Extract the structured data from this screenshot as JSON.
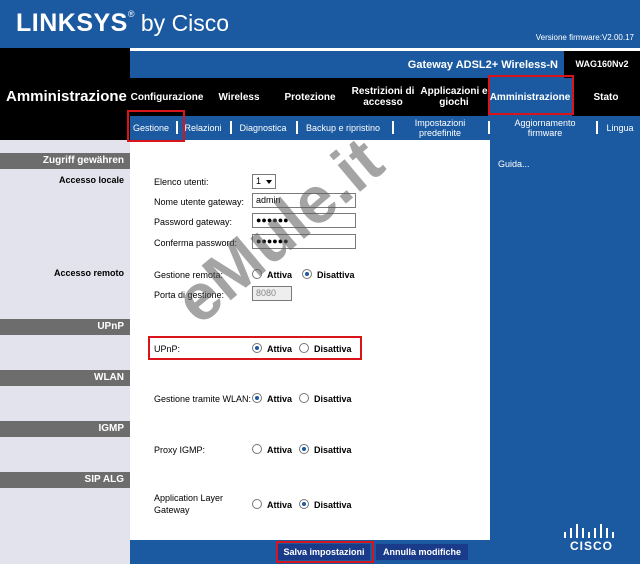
{
  "header": {
    "brand": "LINKSYS",
    "reg": "®",
    "by": " by Cisco",
    "firmware": "Versione firmware:V2.00.17",
    "section_title": "Amministrazione",
    "product_name": "Gateway ADSL2+ Wireless-N",
    "model": "WAG160Nv2"
  },
  "tabs": [
    {
      "label": "Configurazione"
    },
    {
      "label": "Wireless"
    },
    {
      "label": "Protezione"
    },
    {
      "label": "Restrizioni di accesso"
    },
    {
      "label": "Applicazioni e giochi"
    },
    {
      "label": "Amministrazione"
    },
    {
      "label": "Stato"
    }
  ],
  "subtabs": [
    {
      "label": "Gestione"
    },
    {
      "label": "Relazioni"
    },
    {
      "label": "Diagnostica"
    },
    {
      "label": "Backup e ripristino"
    },
    {
      "label": "Impostazioni predefinite"
    },
    {
      "label": "Aggiornamento firmware"
    },
    {
      "label": "Lingua"
    }
  ],
  "left": {
    "zugriff": "Zugriff gewähren",
    "accesso_locale": "Accesso locale",
    "accesso_remoto": "Accesso remoto",
    "upnp": "UPnP",
    "wlan": "WLAN",
    "igmp": "IGMP",
    "sip": "SIP ALG"
  },
  "form": {
    "elenco_utenti_label": "Elenco utenti:",
    "elenco_utenti_value": "1",
    "nome_utente_label": "Nome utente gateway:",
    "nome_utente_value": "admin",
    "password_label": "Password gateway:",
    "password_value": "●●●●●●",
    "conferma_label": "Conferma password:",
    "conferma_value": "●●●●●●",
    "gestione_remota_label": "Gestione remota:",
    "porta_label": "Porta di gestione:",
    "porta_value": "8080",
    "upnp_label": "UPnP:",
    "wlan_label": "Gestione tramite WLAN:",
    "proxy_igmp_label": "Proxy IGMP:",
    "alg_label_1": "Application Layer",
    "alg_label_2": "Gateway",
    "attiva": "Attiva",
    "disattiva": "Disattiva"
  },
  "help": {
    "link": "Guida..."
  },
  "buttons": {
    "save": "Salva impostazioni",
    "cancel": "Annulla modifiche"
  },
  "watermark": "eMule.it",
  "footer_logo": "CISCO",
  "colors": {
    "brand_blue": "#1b5aa0",
    "highlight_red": "#d9141b"
  }
}
